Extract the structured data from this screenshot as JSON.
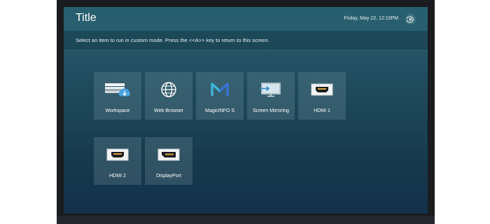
{
  "header": {
    "title": "Title",
    "datetime": "Friday, May 22, 12:10PM"
  },
  "instruction": "Select an item to run in custom mode. Press the <<A>> key to return to this screen.",
  "tiles": [
    {
      "label": "Workspace",
      "icon": "workspace-cloud-icon"
    },
    {
      "label": "Web Browser",
      "icon": "globe-icon"
    },
    {
      "label": "MagicINFO S",
      "icon": "magicinfo-icon"
    },
    {
      "label": "Screen Mirroring",
      "icon": "screen-mirroring-icon"
    },
    {
      "label": "HDMI 1",
      "icon": "hdmi-port-icon"
    },
    {
      "label": "HDMI 2",
      "icon": "hdmi-port-icon"
    },
    {
      "label": "DisplayPort",
      "icon": "displayport-icon"
    }
  ],
  "colors": {
    "accent_blue": "#2f86c8",
    "magicinfo_cyan": "#3fb6d9",
    "magicinfo_blue": "#3a6fd0"
  }
}
